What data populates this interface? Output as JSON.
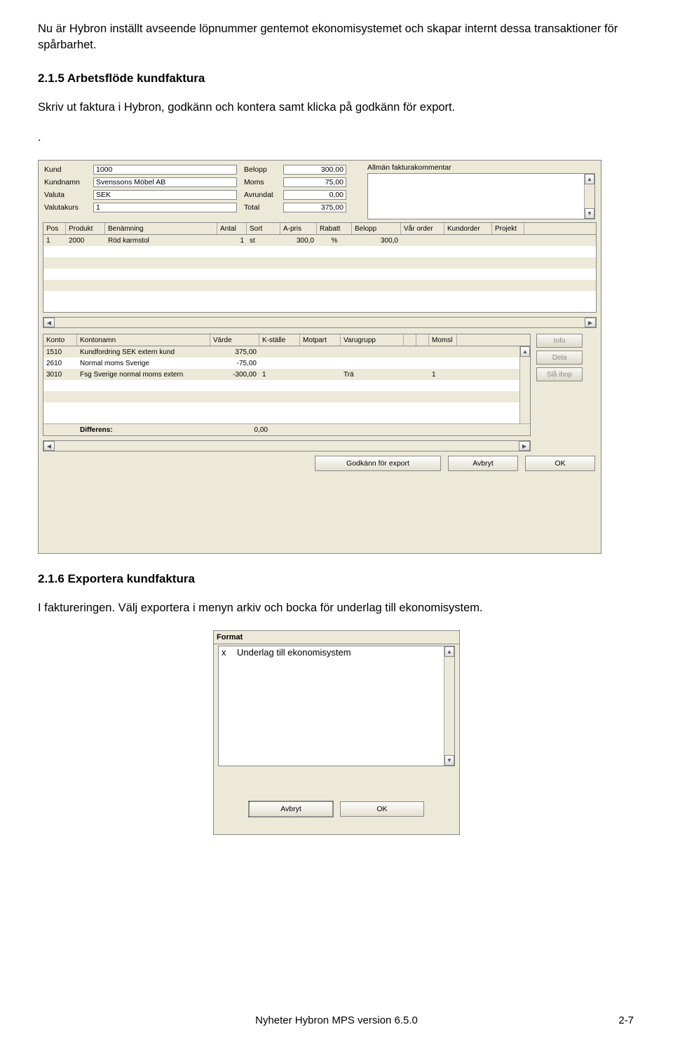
{
  "intro": "Nu är Hybron inställt avseende löpnummer gentemot ekonomisystemet och skapar internt dessa transaktioner för spårbarhet.",
  "sec215_h": "2.1.5  Arbetsflöde kundfaktura",
  "sec215_p": "Skriv ut faktura i Hybron, godkänn och kontera samt klicka på godkänn för export.",
  "dot": ".",
  "hdr": {
    "kund_l": "Kund",
    "kund_v": "1000",
    "kundnamn_l": "Kundnamn",
    "kundnamn_v": "Svenssons Möbel AB",
    "valuta_l": "Valuta",
    "valuta_v": "SEK",
    "valutakurs_l": "Valutakurs",
    "valutakurs_v": "1",
    "belopp_l": "Belopp",
    "belopp_v": "300,00",
    "moms_l": "Moms",
    "moms_v": "75,00",
    "avrundat_l": "Avrundat",
    "avrundat_v": "0,00",
    "total_l": "Total",
    "total_v": "375,00",
    "komm_l": "Allmän fakturakommentar"
  },
  "t1h": {
    "pos": "Pos",
    "prod": "Produkt",
    "ben": "Benämning",
    "ant": "Antal",
    "sort": "Sort",
    "apr": "A-pris",
    "rab": "Rabatt",
    "bel": "Belopp",
    "vo": "Vår order",
    "ko": "Kundorder",
    "pr": "Projekt"
  },
  "t1r": {
    "pos": "1",
    "prod": "2000",
    "ben": "Röd karmstol",
    "ant": "1",
    "sort": "st",
    "apr": "300,0",
    "rab": "%",
    "bel": "300,0"
  },
  "t2h": {
    "k": "Konto",
    "kn": "Kontonamn",
    "v": "Värde",
    "ks": "K-ställe",
    "mp": "Motpart",
    "vg": "Varugrupp",
    "mo": "Momsl"
  },
  "t2r1": {
    "k": "1510",
    "kn": "Kundfordring SEK extern kund",
    "v": "375,00"
  },
  "t2r2": {
    "k": "2610",
    "kn": "Normal moms Sverige",
    "v": "-75,00"
  },
  "t2r3": {
    "k": "3010",
    "kn": "Fsg Sverige normal moms extern",
    "v": "-300,00",
    "ks": "1",
    "vg": "Trä",
    "mo": "1"
  },
  "diff_l": "Differens:",
  "diff_v": "0,00",
  "btns": {
    "info": "Info",
    "dela": "Dela",
    "sla": "Slå ihop",
    "god": "Godkänn för export",
    "avb": "Avbryt",
    "ok": "OK"
  },
  "sec216_h": "2.1.6  Exportera kundfaktura",
  "sec216_p": "I faktureringen. Välj exportera i menyn arkiv och bocka för underlag till ekonomisystem.",
  "w2": {
    "hdr": "Format",
    "x": "x",
    "opt": "Underlag till ekonomisystem",
    "avb": "Avbryt",
    "ok": "OK"
  },
  "footer": "Nyheter Hybron MPS version 6.5.0",
  "pagenum": "2-7"
}
